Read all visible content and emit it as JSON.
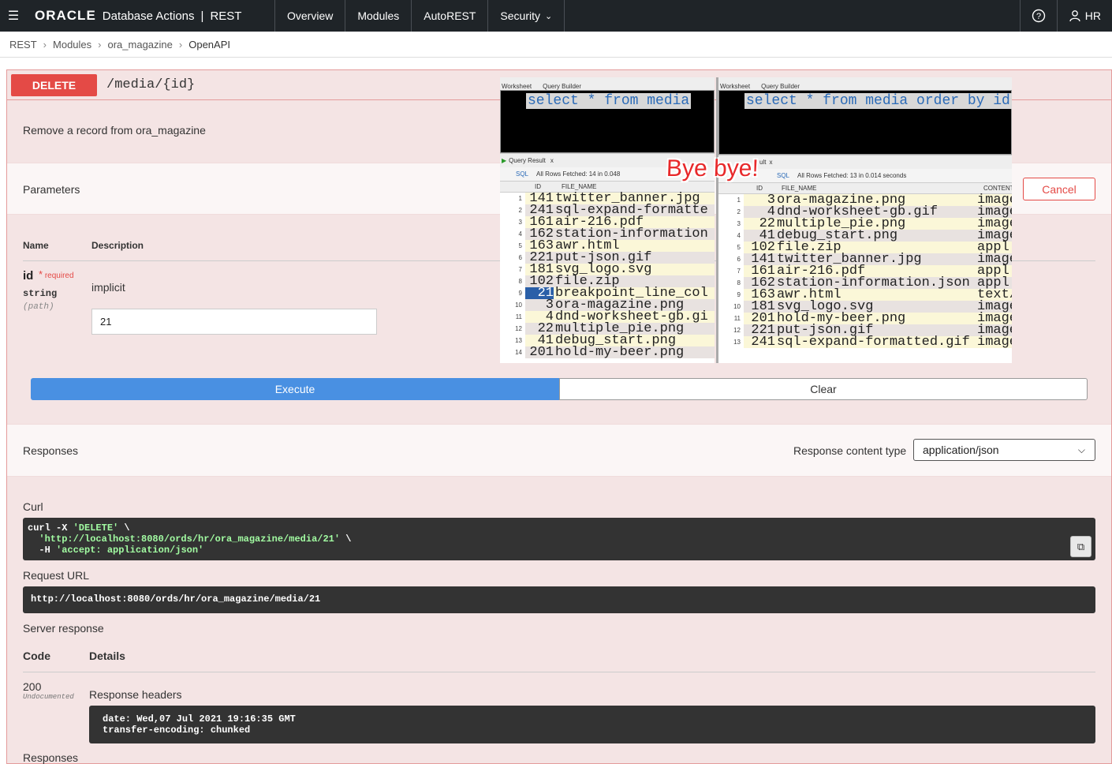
{
  "topbar": {
    "logo": "ORACLE",
    "app": "Database Actions",
    "separator": "|",
    "section": "REST",
    "nav": [
      "Overview",
      "Modules",
      "AutoREST",
      "Security"
    ],
    "user": "HR",
    "icons": {
      "menu": "menu-icon",
      "help": "help-icon",
      "user": "user-icon",
      "chevron": "chevron-down-icon"
    }
  },
  "breadcrumb": [
    "REST",
    "Modules",
    "ora_magazine",
    "OpenAPI"
  ],
  "operation": {
    "method": "DELETE",
    "path": "/media/{id}",
    "summary": "Remove a record from ora_magazine",
    "color": "#e44a46"
  },
  "parameters": {
    "title": "Parameters",
    "cancel": "Cancel",
    "col_name": "Name",
    "col_desc": "Description",
    "param": {
      "name": "id",
      "required_mark": "*",
      "required": "required",
      "type": "string",
      "in": "(path)",
      "description": "implicit",
      "value": "21"
    }
  },
  "actions": {
    "execute": "Execute",
    "clear": "Clear"
  },
  "responses": {
    "title": "Responses",
    "content_type_label": "Response content type",
    "content_type": "application/json",
    "curl_label": "Curl",
    "curl_lines": [
      "curl -X 'DELETE' \\",
      "'http://localhost:8080/ords/hr/ora_magazine/media/21' \\",
      "-H 'accept: application/json'"
    ],
    "request_url_label": "Request URL",
    "request_url": "http://localhost:8080/ords/hr/ora_magazine/media/21",
    "server_response": "Server response",
    "code_col": "Code",
    "details_col": "Details",
    "code": "200",
    "undocumented": "Undocumented",
    "response_headers": "Response headers",
    "headers": [
      "date: Wed,07 Jul 2021 19:16:35 GMT",
      "transfer-encoding: chunked"
    ],
    "bottom": "Responses"
  },
  "overlay": {
    "left": {
      "tabs": [
        "Worksheet",
        "Query Builder"
      ],
      "sql": "select * from media",
      "result_tab": "Query Result",
      "fetched": "All Rows Fetched: 14 in 0.048",
      "sql_btn": "SQL",
      "cols": [
        "ID",
        "FILE_NAME"
      ],
      "rows": [
        [
          "1",
          "141",
          "twitter_banner.jpg"
        ],
        [
          "2",
          "241",
          "sql-expand-formatte"
        ],
        [
          "3",
          "161",
          "air-216.pdf"
        ],
        [
          "4",
          "162",
          "station-information"
        ],
        [
          "5",
          "163",
          "awr.html"
        ],
        [
          "6",
          "221",
          "put-json.gif"
        ],
        [
          "7",
          "181",
          "svg_logo.svg"
        ],
        [
          "8",
          "102",
          "file.zip"
        ],
        [
          "9",
          "21",
          "breakpoint_line_col"
        ],
        [
          "10",
          "3",
          "ora-magazine.png"
        ],
        [
          "11",
          "4",
          "dnd-worksheet-gb.gi"
        ],
        [
          "12",
          "22",
          "multiple_pie.png"
        ],
        [
          "13",
          "41",
          "debug_start.png"
        ],
        [
          "14",
          "201",
          "hold-my-beer.png"
        ]
      ]
    },
    "right": {
      "tabs": [
        "Worksheet",
        "Query Builder"
      ],
      "sql": "select * from media order by id",
      "result_tab": "ult",
      "fetched": "All Rows Fetched: 13 in 0.014 seconds",
      "sql_btn": "SQL",
      "cols": [
        "ID",
        "FILE_NAME",
        "CONTENT_"
      ],
      "rows": [
        [
          "1",
          "3",
          "ora-magazine.png",
          "image"
        ],
        [
          "2",
          "4",
          "dnd-worksheet-gb.gif",
          "image"
        ],
        [
          "3",
          "22",
          "multiple_pie.png",
          "image"
        ],
        [
          "4",
          "41",
          "debug_start.png",
          "image"
        ],
        [
          "5",
          "102",
          "file.zip",
          "appl"
        ],
        [
          "6",
          "141",
          "twitter_banner.jpg",
          "image"
        ],
        [
          "7",
          "161",
          "air-216.pdf",
          "appl"
        ],
        [
          "8",
          "162",
          "station-information.json",
          "appl"
        ],
        [
          "9",
          "163",
          "awr.html",
          "text/"
        ],
        [
          "10",
          "181",
          "svg_logo.svg",
          "image"
        ],
        [
          "11",
          "201",
          "hold-my-beer.png",
          "image"
        ],
        [
          "12",
          "221",
          "put-json.gif",
          "image"
        ],
        [
          "13",
          "241",
          "sql-expand-formatted.gif",
          "image"
        ]
      ]
    },
    "caption": "Bye bye!"
  }
}
